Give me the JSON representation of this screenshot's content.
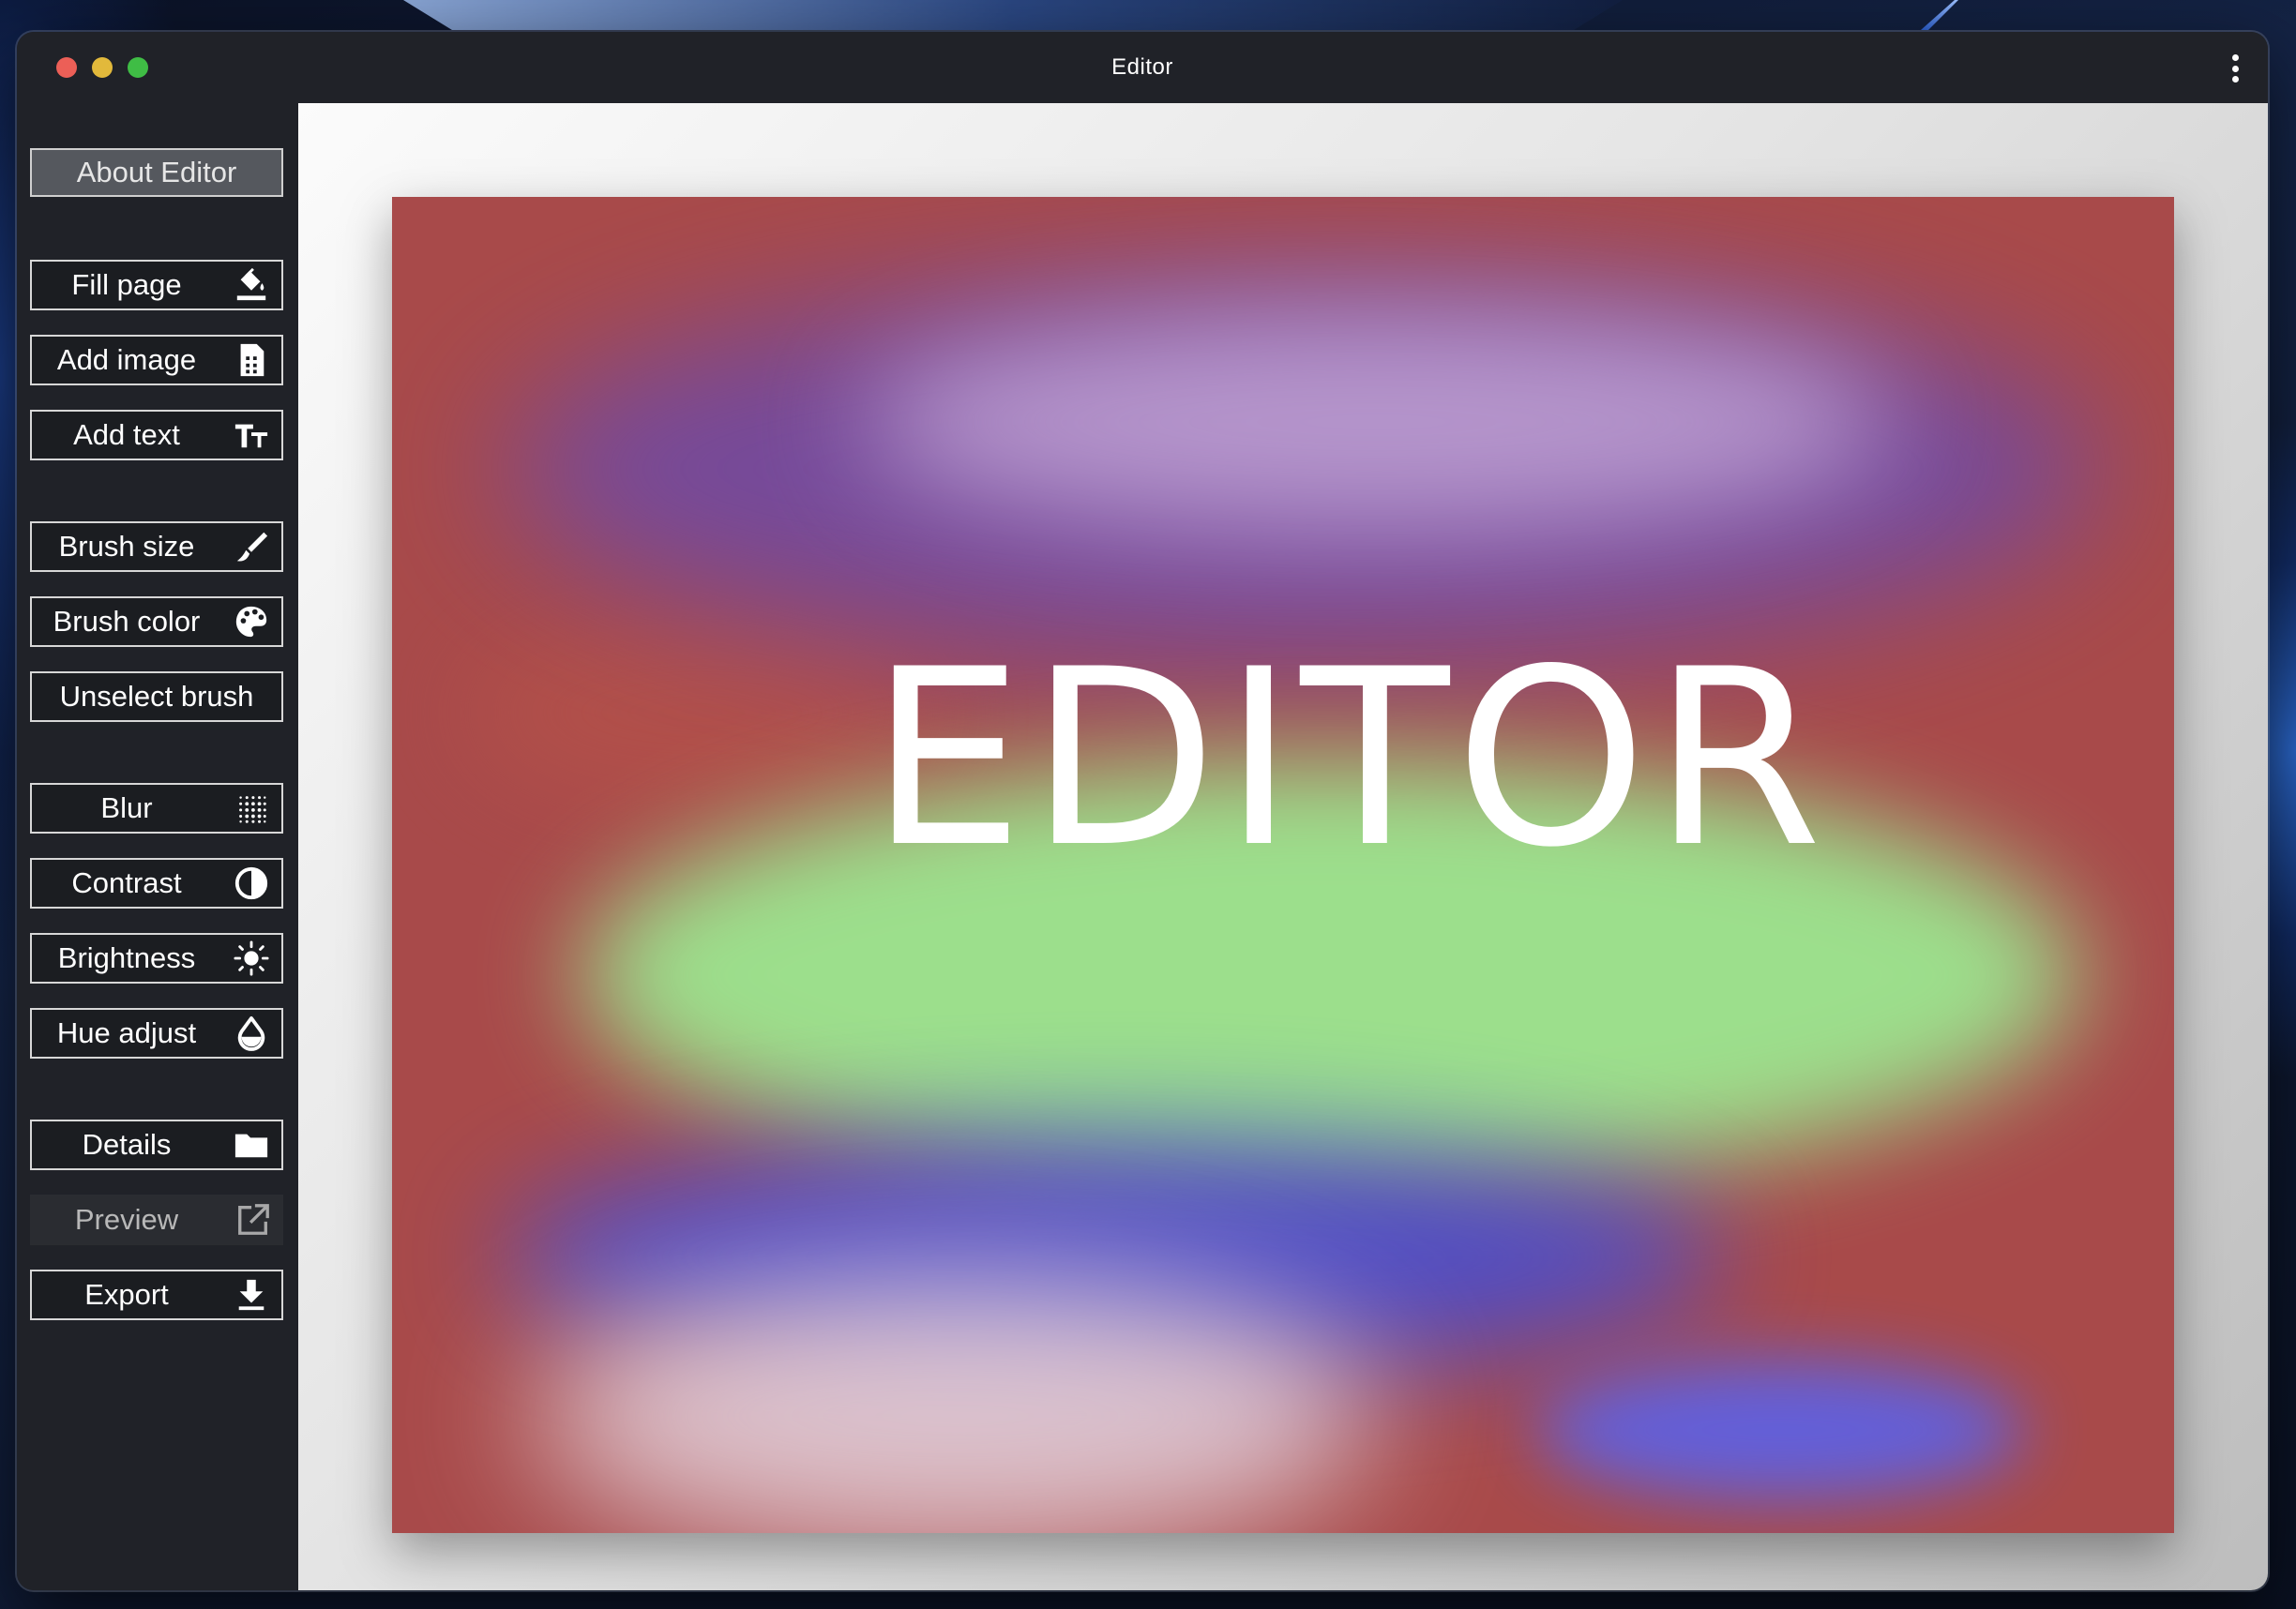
{
  "window": {
    "title": "Editor"
  },
  "sidebar": {
    "about": "About Editor",
    "fill_page": "Fill page",
    "add_image": "Add image",
    "add_text": "Add text",
    "brush_size": "Brush size",
    "brush_color": "Brush color",
    "unselect_brush": "Unselect brush",
    "blur": "Blur",
    "contrast": "Contrast",
    "brightness": "Brightness",
    "hue_adjust": "Hue adjust",
    "details": "Details",
    "preview": "Preview",
    "export": "Export"
  },
  "canvas": {
    "text": "EDITOR"
  },
  "colors": {
    "traffic_red": "#ec5f57",
    "traffic_yellow": "#e2b93b",
    "traffic_green": "#3fbd45",
    "sidebar_bg": "#202228"
  }
}
